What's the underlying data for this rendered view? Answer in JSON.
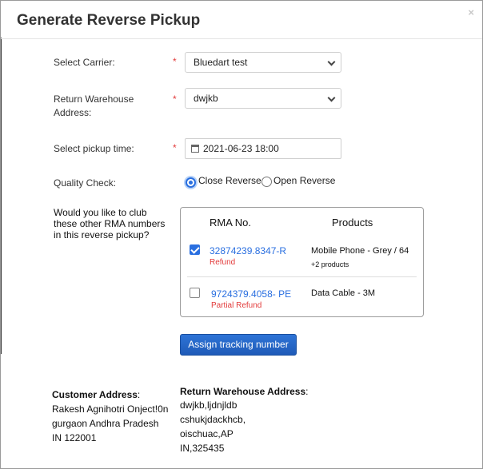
{
  "modal": {
    "title": "Generate Reverse Pickup",
    "close_glyph": "×"
  },
  "form": {
    "required_mark": "*",
    "carrier": {
      "label": "Select Carrier:",
      "value": "Bluedart test"
    },
    "warehouse": {
      "label_line1": "Return Warehouse",
      "label_line2": "Address:",
      "value": "dwjkb"
    },
    "pickup_time": {
      "label": "Select pickup time:",
      "value": "2021-06-23 18:00"
    },
    "quality_check": {
      "label": "Quality Check:",
      "options": [
        {
          "label": "Close Reverse",
          "checked": true
        },
        {
          "label": "Open Reverse",
          "checked": false
        }
      ]
    }
  },
  "club": {
    "question_line1": "Would you like to club",
    "question_line2": "these other RMA numbers",
    "question_line3": "in this reverse pickup?",
    "headers": {
      "rma": "RMA No.",
      "products": "Products"
    },
    "rows": [
      {
        "checked": true,
        "rma": "32874239.8347-R",
        "type": "Refund",
        "product": "Mobile Phone - Grey / 64",
        "more": "+2 products"
      },
      {
        "checked": false,
        "rma": "9724379.4058- PE",
        "type": "Partial Refund",
        "product": "Data Cable - 3M",
        "more": ""
      }
    ]
  },
  "assign_button": "Assign tracking number",
  "customer_address": {
    "heading": "Customer Address",
    "colon": ":",
    "lines": [
      "Rakesh Agnihotri Onject!0n",
      "gurgaon Andhra Pradesh",
      "IN 122001"
    ]
  },
  "return_address": {
    "heading": "Return Warehouse Address",
    "colon": ":",
    "lines": [
      "dwjkb,ljdnjldb",
      "cshukjdackhcb,",
      "oischuac,AP",
      "IN,325435"
    ]
  },
  "colors": {
    "accent": "#2a6fe0",
    "required": "#e23b3b",
    "button": "#1f5bb8"
  }
}
